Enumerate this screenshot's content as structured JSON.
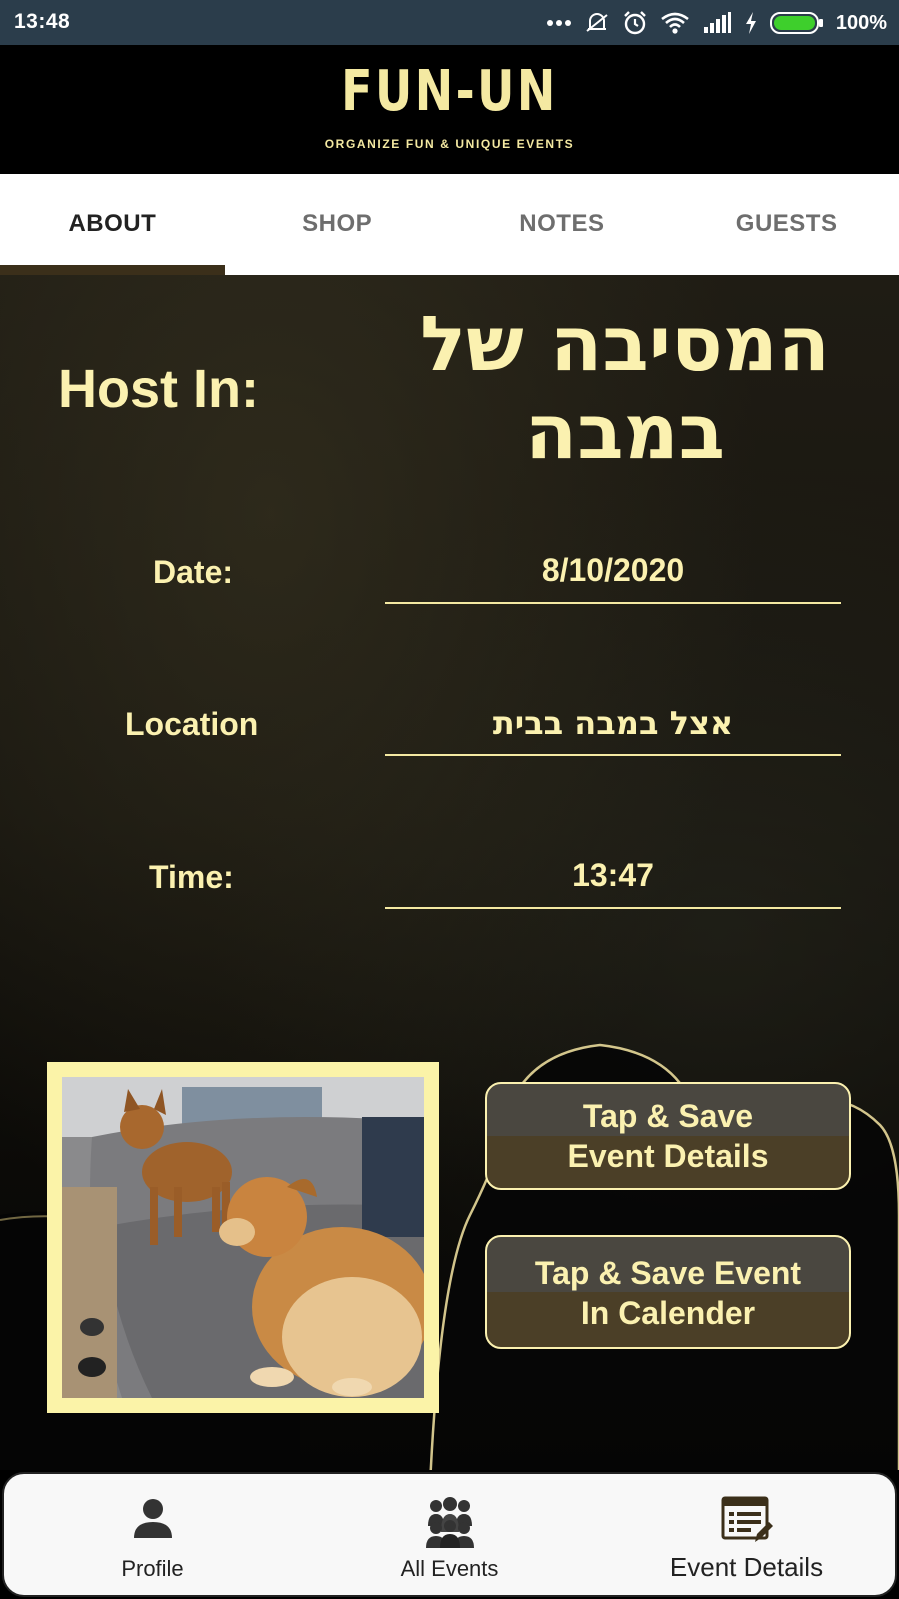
{
  "status_bar": {
    "time": "13:48",
    "battery": "100%",
    "icons": [
      "more-dots-icon",
      "mute-icon",
      "alarm-icon",
      "wifi-icon",
      "signal-icon",
      "charging-icon",
      "battery-icon"
    ]
  },
  "header": {
    "logo": "FUN-UN",
    "tagline": "ORGANIZE FUN & UNIQUE EVENTS",
    "accent_color": "#f4e9a2"
  },
  "tabs": [
    {
      "label": "ABOUT",
      "active": true
    },
    {
      "label": "SHOP",
      "active": false
    },
    {
      "label": "NOTES",
      "active": false
    },
    {
      "label": "GUESTS",
      "active": false
    }
  ],
  "event": {
    "host_label": "Host In:",
    "host_value": "המסיבה של במבה",
    "date_label": "Date:",
    "date_value": "8/10/2020",
    "location_label": "Location",
    "location_value": "אצל במבה בבית",
    "time_label": "Time:",
    "time_value": "13:47"
  },
  "buttons": {
    "save_details_line1": "Tap & Save",
    "save_details_line2": "Event Details",
    "save_calendar_line1": "Tap & Save Event",
    "save_calendar_line2": "In Calender"
  },
  "bottom_nav": [
    {
      "label": "Profile",
      "icon": "person-icon",
      "active": false
    },
    {
      "label": "All Events",
      "icon": "group-icon",
      "active": false
    },
    {
      "label": "Event Details",
      "icon": "event-list-icon",
      "active": true
    }
  ]
}
